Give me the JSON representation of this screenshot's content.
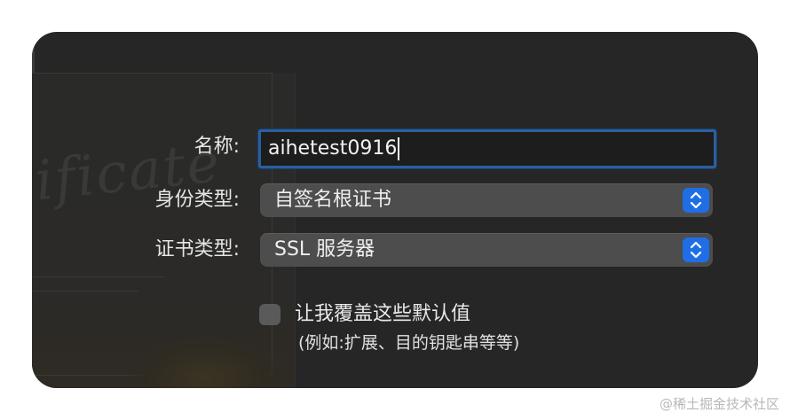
{
  "form": {
    "name_label": "名称:",
    "name_value": "aihetest0916",
    "identity_type_label": "身份类型:",
    "identity_type_value": "自签名根证书",
    "cert_type_label": "证书类型:",
    "cert_type_value": "SSL 服务器",
    "override_defaults_label": "让我覆盖这些默认值",
    "override_defaults_checked": false,
    "override_hint": "(例如:扩展、目的钥匙串等等)"
  },
  "background": {
    "art_text": "ificate"
  },
  "watermark": "@稀土掘金技术社区",
  "colors": {
    "panel": "#262626",
    "accent": "#1f6ee6",
    "focus_ring": "#2b5f9e",
    "control": "#4d4d4d"
  },
  "icons": {
    "stepper": "up-down-chevron-icon"
  }
}
